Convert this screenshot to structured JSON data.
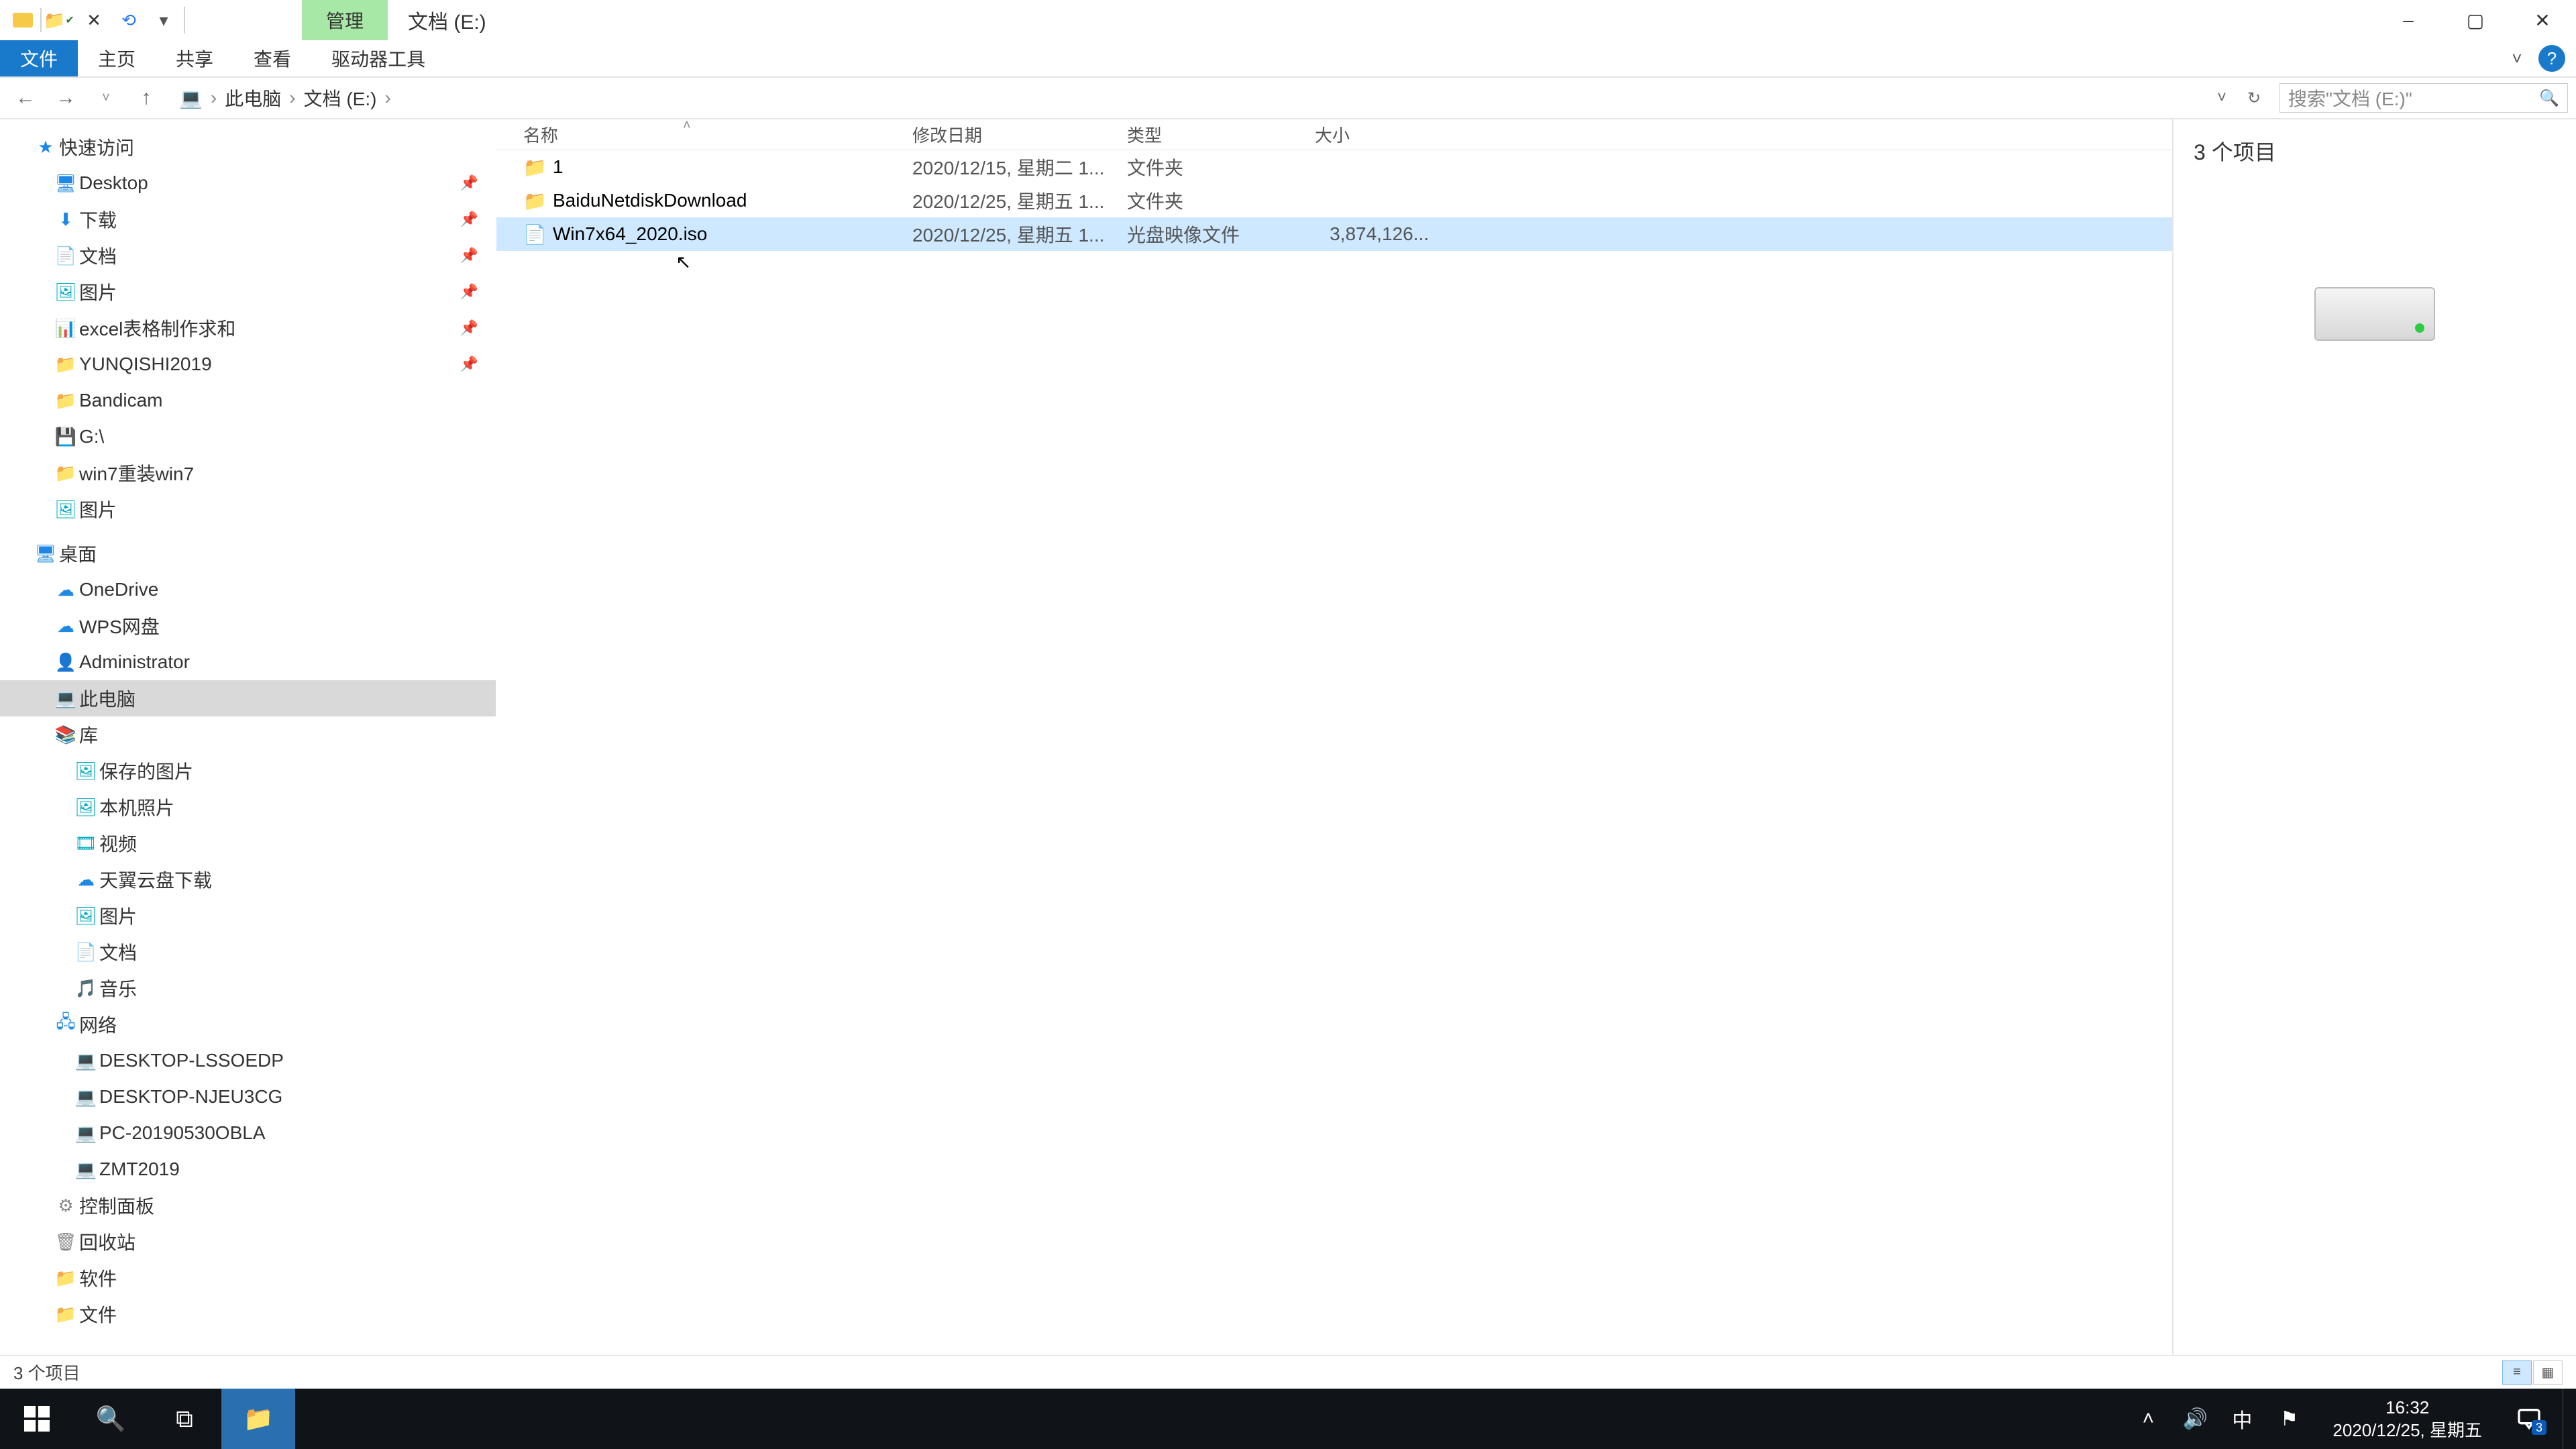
{
  "window": {
    "context_tab": "管理",
    "title": "文档 (E:)",
    "minimize": "–",
    "maximize": "▢",
    "close": "✕"
  },
  "ribbon": {
    "file": "文件",
    "home": "主页",
    "share": "共享",
    "view": "查看",
    "drive_tools": "驱动器工具"
  },
  "addressbar": {
    "back": "←",
    "forward": "→",
    "up": "↑",
    "crumbs": [
      "此电脑",
      "文档 (E:)"
    ],
    "refresh": "↻",
    "dropdown": "˅"
  },
  "search": {
    "placeholder": "搜索\"文档 (E:)\"",
    "icon": "🔍"
  },
  "columns": {
    "name": "名称",
    "date": "修改日期",
    "type": "类型",
    "size": "大小"
  },
  "rows": [
    {
      "icon": "📁",
      "name": "1",
      "date": "2020/12/15, 星期二 1...",
      "type": "文件夹",
      "size": "",
      "selected": false
    },
    {
      "icon": "📁",
      "name": "BaiduNetdiskDownload",
      "date": "2020/12/25, 星期五 1...",
      "type": "文件夹",
      "size": "",
      "selected": false
    },
    {
      "icon": "📄",
      "name": "Win7x64_2020.iso",
      "date": "2020/12/25, 星期五 1...",
      "type": "光盘映像文件",
      "size": "3,874,126...",
      "selected": true
    }
  ],
  "nav": {
    "quick_access": "快速访问",
    "quick_items": [
      {
        "icon": "🖥",
        "label": "Desktop",
        "pinned": true,
        "cls": "c-blue"
      },
      {
        "icon": "⬇",
        "label": "下载",
        "pinned": true,
        "cls": "c-blue"
      },
      {
        "icon": "📄",
        "label": "文档",
        "pinned": true,
        "cls": "c-yellow"
      },
      {
        "icon": "🖼",
        "label": "图片",
        "pinned": true,
        "cls": "c-cyan"
      },
      {
        "icon": "📊",
        "label": "excel表格制作求和",
        "pinned": true,
        "cls": "c-yellow"
      },
      {
        "icon": "📁",
        "label": "YUNQISHI2019",
        "pinned": true,
        "cls": "c-yellow"
      },
      {
        "icon": "📁",
        "label": "Bandicam",
        "pinned": false,
        "cls": "c-yellow"
      },
      {
        "icon": "💾",
        "label": "G:\\",
        "pinned": false,
        "cls": "c-blue"
      },
      {
        "icon": "📁",
        "label": "win7重装win7",
        "pinned": false,
        "cls": "c-yellow"
      },
      {
        "icon": "🖼",
        "label": "图片",
        "pinned": false,
        "cls": "c-cyan"
      }
    ],
    "desktop": "桌面",
    "desktop_items": [
      {
        "icon": "☁",
        "label": "OneDrive",
        "cls": "c-blue"
      },
      {
        "icon": "☁",
        "label": "WPS网盘",
        "cls": "c-blue"
      },
      {
        "icon": "👤",
        "label": "Administrator",
        "cls": "c-orange"
      },
      {
        "icon": "💻",
        "label": "此电脑",
        "cls": "c-blue",
        "selected": true
      },
      {
        "icon": "📚",
        "label": "库",
        "cls": "c-orange"
      }
    ],
    "library_items": [
      {
        "icon": "🖼",
        "label": "保存的图片",
        "cls": "c-cyan"
      },
      {
        "icon": "🖼",
        "label": "本机照片",
        "cls": "c-cyan"
      },
      {
        "icon": "🎞",
        "label": "视频",
        "cls": "c-cyan"
      },
      {
        "icon": "☁",
        "label": "天翼云盘下载",
        "cls": "c-blue"
      },
      {
        "icon": "🖼",
        "label": "图片",
        "cls": "c-cyan"
      },
      {
        "icon": "📄",
        "label": "文档",
        "cls": "c-yellow"
      },
      {
        "icon": "🎵",
        "label": "音乐",
        "cls": "c-cyan"
      }
    ],
    "network": "网络",
    "network_items": [
      {
        "icon": "💻",
        "label": "DESKTOP-LSSOEDP",
        "cls": "c-blue"
      },
      {
        "icon": "💻",
        "label": "DESKTOP-NJEU3CG",
        "cls": "c-blue"
      },
      {
        "icon": "💻",
        "label": "PC-20190530OBLA",
        "cls": "c-blue"
      },
      {
        "icon": "💻",
        "label": "ZMT2019",
        "cls": "c-blue"
      }
    ],
    "extras": [
      {
        "icon": "⚙",
        "label": "控制面板",
        "cls": "c-gray"
      },
      {
        "icon": "🗑",
        "label": "回收站",
        "cls": "c-gray"
      },
      {
        "icon": "📁",
        "label": "软件",
        "cls": "c-yellow"
      },
      {
        "icon": "📁",
        "label": "文件",
        "cls": "c-yellow"
      }
    ]
  },
  "details": {
    "summary": "3 个项目"
  },
  "status": {
    "text": "3 个项目"
  },
  "taskbar": {
    "ime": "中",
    "time": "16:32",
    "date": "2020/12/25, 星期五",
    "notifications": "3"
  }
}
